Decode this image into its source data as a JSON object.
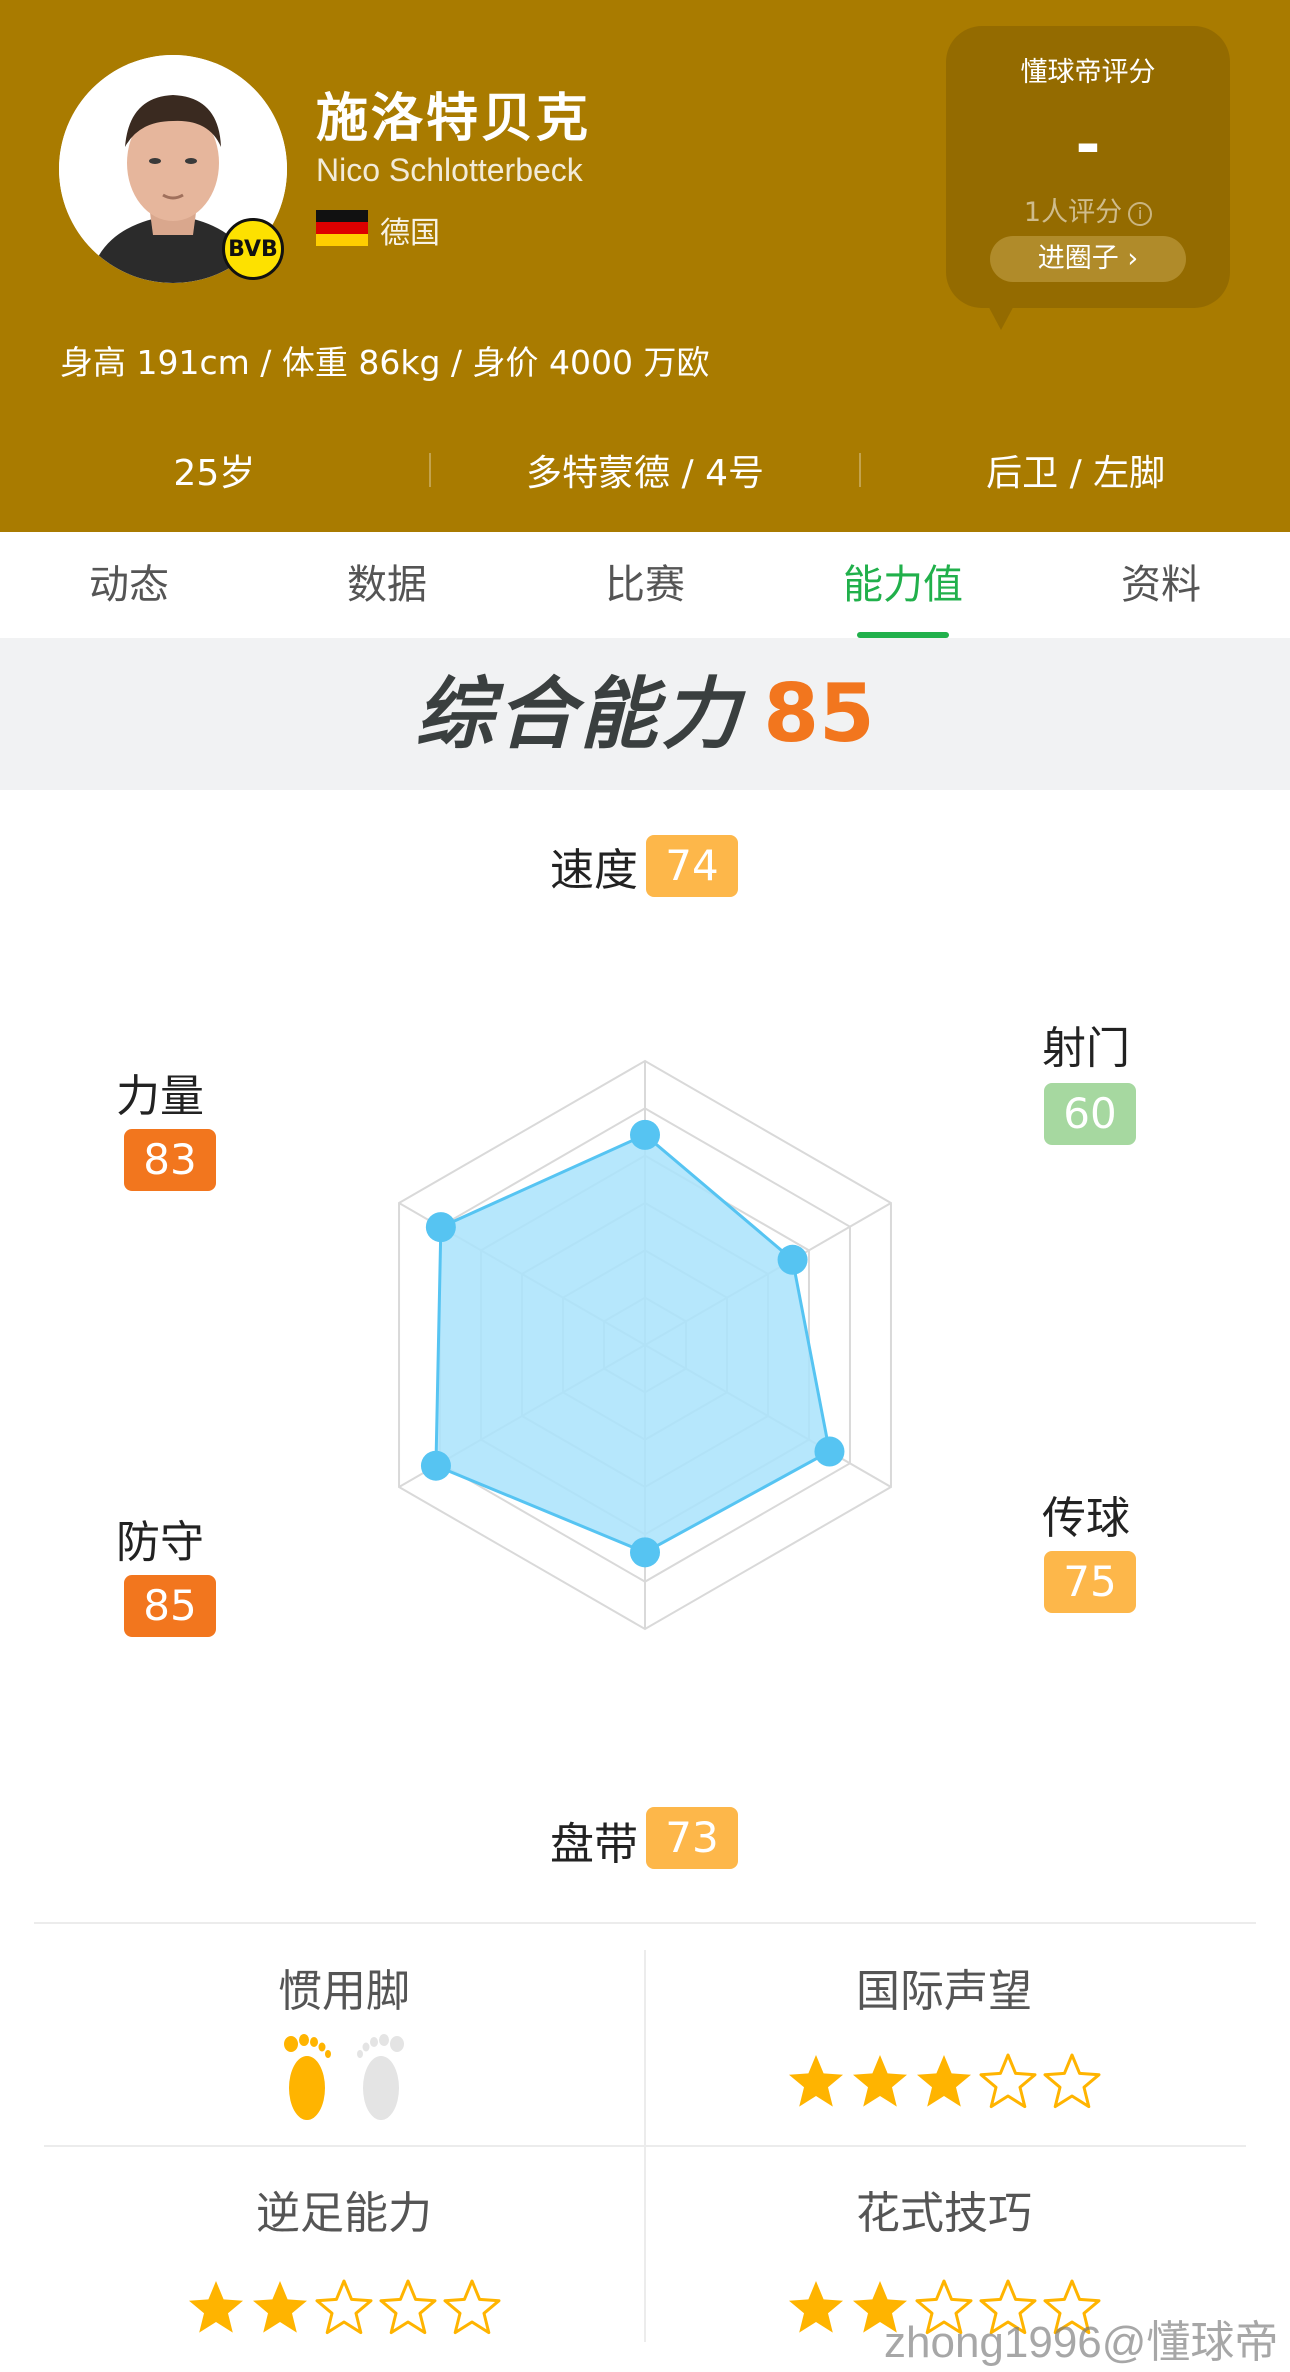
{
  "player": {
    "name_cn": "施洛特贝克",
    "name_en": "Nico Schlotterbeck",
    "country": "德国",
    "club_badge": "BVB",
    "physique": "身高 191cm / 体重 86kg / 身价 4000 万欧",
    "age": "25岁",
    "club_number": "多特蒙德 / 4号",
    "position_foot": "后卫 / 左脚"
  },
  "rating": {
    "title": "懂球帝评分",
    "value": "-",
    "count": "1人评分",
    "info_icon": "i",
    "join_label": "进圈子 ›"
  },
  "tabs": [
    {
      "label": "动态",
      "active": false
    },
    {
      "label": "数据",
      "active": false
    },
    {
      "label": "比赛",
      "active": false
    },
    {
      "label": "能力值",
      "active": true
    },
    {
      "label": "资料",
      "active": false
    }
  ],
  "overall": {
    "label": "综合能力",
    "value": "85"
  },
  "chart_data": {
    "type": "radar",
    "max": 100,
    "axes": [
      {
        "label": "速度",
        "value": 74,
        "color": "#FDB74A"
      },
      {
        "label": "射门",
        "value": 60,
        "color": "#A6D8A0"
      },
      {
        "label": "传球",
        "value": 75,
        "color": "#FDB74A"
      },
      {
        "label": "盘带",
        "value": 73,
        "color": "#FDB74A"
      },
      {
        "label": "防守",
        "value": 85,
        "color": "#F2761E"
      },
      {
        "label": "力量",
        "value": 83,
        "color": "#F2761E"
      }
    ],
    "fill_color": "#A9E3FC",
    "line_color": "#56C4F2",
    "grid_color": "#D9D9D9"
  },
  "attributes": {
    "preferred_foot": {
      "title": "惯用脚",
      "left_active": true,
      "right_active": false
    },
    "reputation": {
      "title": "国际声望",
      "stars": 3,
      "max": 5
    },
    "weak_foot": {
      "title": "逆足能力",
      "stars": 2,
      "max": 5
    },
    "skill_moves": {
      "title": "花式技巧",
      "stars": 2,
      "max": 5
    }
  },
  "colors": {
    "header": "#A97B00",
    "accent_green": "#21B04B",
    "star": "#FFB400"
  },
  "watermark": "zhong1996@懂球帝"
}
